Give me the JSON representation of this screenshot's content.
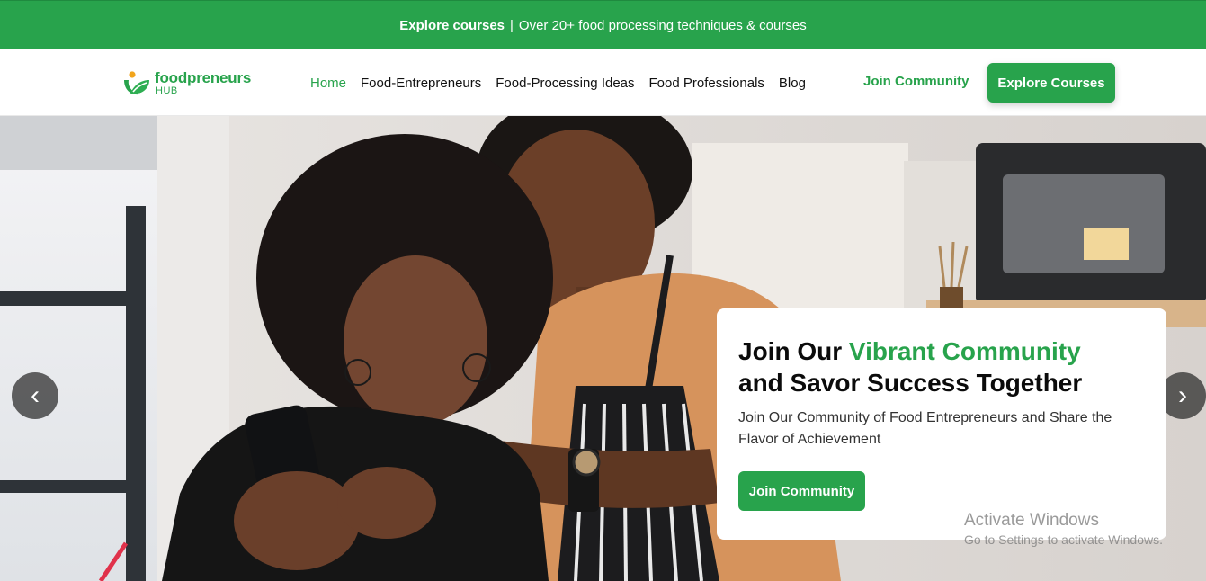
{
  "announcement": {
    "link_label": "Explore courses",
    "separator": "|",
    "text": "Over 20+ food processing techniques & courses"
  },
  "header": {
    "logo": {
      "word": "foodpreneurs",
      "sub": "HUB"
    },
    "nav": [
      {
        "label": "Home",
        "active": true
      },
      {
        "label": "Food-Entrepreneurs",
        "active": false
      },
      {
        "label": "Food-Processing Ideas",
        "active": false
      },
      {
        "label": "Food Professionals",
        "active": false
      },
      {
        "label": "Blog",
        "active": false
      }
    ],
    "join_link": "Join Community",
    "explore_button": "Explore Courses"
  },
  "hero": {
    "prev_arrow": "‹",
    "next_arrow": "›",
    "card": {
      "title_part1": "Join Our ",
      "title_highlight": "Vibrant Community",
      "title_part2": "and Savor Success Together",
      "description": "Join Our Community of Food Entrepreneurs and Share the Flavor of Achievement",
      "cta_label": "Join Community"
    }
  },
  "os_watermark": {
    "line1": "Activate Windows",
    "line2": "Go to Settings to activate Windows."
  },
  "colors": {
    "brand_green": "#28a34c",
    "text_dark": "#111111"
  }
}
